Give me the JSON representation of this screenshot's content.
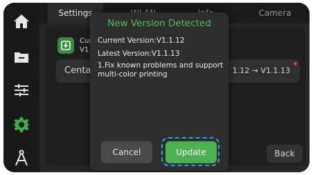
{
  "tabs": [
    {
      "label": "Settings",
      "active": true
    },
    {
      "label": "WLAN",
      "active": false
    },
    {
      "label": "Info",
      "active": false
    },
    {
      "label": "Camera",
      "active": false
    }
  ],
  "sidebar": {
    "items": [
      {
        "icon": "home-icon"
      },
      {
        "icon": "folder-icon"
      },
      {
        "icon": "sliders-icon"
      },
      {
        "icon": "gear-icon",
        "active": true
      },
      {
        "icon": "compass-tool-icon"
      }
    ],
    "active_color": "#3cae44"
  },
  "firmware": {
    "line1": "Cur",
    "line2": "V1.",
    "row_name": "Centau",
    "row_version": "1.12 → V1.1.13"
  },
  "back_label": "Back",
  "dialog": {
    "title": "New Version Detected",
    "current": "Current Version:V1.1.12",
    "latest": "Latest Version:V1.1.13",
    "notes": "1.Fix known problems and support multi-color printing",
    "cancel_label": "Cancel",
    "update_label": "Update"
  },
  "colors": {
    "accent_green": "#4bb04f",
    "title_green": "#4bc15a",
    "highlight_blue": "#2aa6e8",
    "dot_red": "#e23a3a"
  }
}
